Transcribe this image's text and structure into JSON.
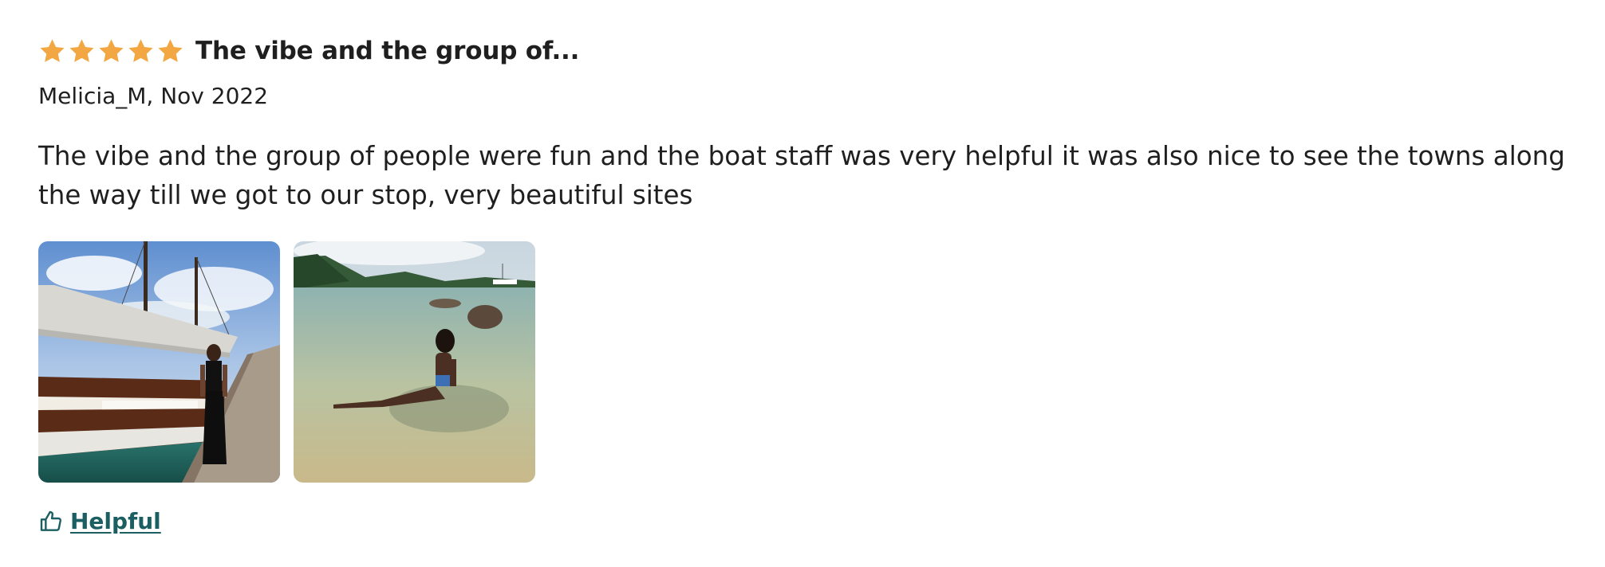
{
  "review": {
    "rating": 5,
    "rating_max": 5,
    "star_color": "#f2a743",
    "star_icon": "star-icon",
    "title": "The vibe and the group of...",
    "meta": "Melicia_M, Nov 2022",
    "text": "The vibe and the group of people were fun and the boat staff was very helpful it was also nice to see the towns along the way till we got to our stop, very beautiful sites",
    "photos": [
      {
        "name": "review-photo-boat"
      },
      {
        "name": "review-photo-beach"
      }
    ],
    "helpful": {
      "label": "Helpful",
      "icon": "thumbs-up-icon",
      "color": "#1b5f62"
    }
  }
}
